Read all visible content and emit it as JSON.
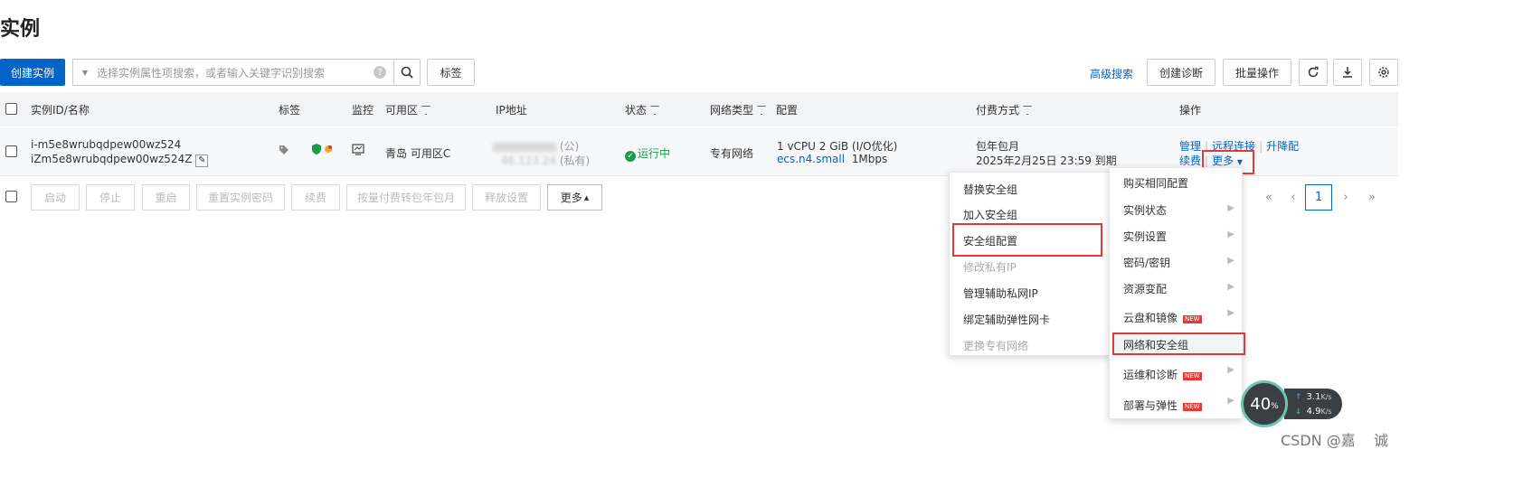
{
  "page": {
    "title": "实例"
  },
  "toolbar": {
    "create_label": "创建实例",
    "search_placeholder": "选择实例属性项搜索，或者输入关键字识别搜索",
    "help_glyph": "?",
    "tag_label": "标签",
    "advanced_search_label": "高级搜索",
    "diagnose_label": "创建诊断",
    "batch_label": "批量操作"
  },
  "table": {
    "headers": {
      "id": "实例ID/名称",
      "tag": "标签",
      "monitor": "监控",
      "zone": "可用区",
      "ip": "IP地址",
      "status": "状态",
      "network": "网络类型",
      "config": "配置",
      "billing": "付费方式",
      "actions": "操作"
    },
    "row": {
      "id": "i-m5e8wrubqdpew00wz524",
      "name": "iZm5e8wrubqdpew00wz524Z",
      "zone": "青岛 可用区C",
      "ip_public_label": "(公)",
      "ip_private_partial": "46.123.24",
      "ip_private_label": "(私有)",
      "status": "运行中",
      "network": "专有网络",
      "config_line1": "1 vCPU 2 GiB  (I/O优化)",
      "config_spec": "ecs.n4.small",
      "config_bw": "1Mbps",
      "billing_line1": "包年包月",
      "billing_line2": "2025年2月25日 23:59 到期",
      "action_manage": "管理",
      "action_remote": "远程连接",
      "action_upgrade": "升降配",
      "action_renew": "续费",
      "action_more": "更多"
    }
  },
  "batch_bar": {
    "buttons": [
      "启动",
      "停止",
      "重启",
      "重置实例密码",
      "续费",
      "按量付费转包年包月",
      "释放设置"
    ],
    "more_label": "更多"
  },
  "pagination": {
    "first": "«",
    "prev": "‹",
    "current": "1",
    "next": "›",
    "last": "»"
  },
  "more_menu": {
    "items": [
      {
        "label": "购买相同配置",
        "submenu": false,
        "new": false
      },
      {
        "label": "实例状态",
        "submenu": true,
        "new": false
      },
      {
        "label": "实例设置",
        "submenu": true,
        "new": false
      },
      {
        "label": "密码/密钥",
        "submenu": true,
        "new": false
      },
      {
        "label": "资源变配",
        "submenu": true,
        "new": false
      },
      {
        "label": "云盘和镜像",
        "submenu": true,
        "new": true
      },
      {
        "label": "网络和安全组",
        "submenu": true,
        "new": false
      },
      {
        "label": "运维和诊断",
        "submenu": true,
        "new": true
      },
      {
        "label": "部署与弹性",
        "submenu": true,
        "new": true
      }
    ],
    "new_badge": "NEW"
  },
  "network_submenu": {
    "items": [
      {
        "label": "替换安全组",
        "disabled": false
      },
      {
        "label": "加入安全组",
        "disabled": false
      },
      {
        "label": "安全组配置",
        "disabled": false
      },
      {
        "label": "修改私有IP",
        "disabled": true
      },
      {
        "label": "管理辅助私网IP",
        "disabled": false
      },
      {
        "label": "绑定辅助弹性网卡",
        "disabled": false
      },
      {
        "label": "更换专有网络",
        "disabled": true
      }
    ]
  },
  "speed_widget": {
    "percent": "40",
    "percent_unit": "%",
    "up": "3.1",
    "down": "4.9",
    "unit": "K/s"
  },
  "watermark": "CSDN @嘉    诚",
  "colors": {
    "primary": "#0064c8",
    "highlight": "#e53935",
    "running": "#1a9c4a"
  }
}
